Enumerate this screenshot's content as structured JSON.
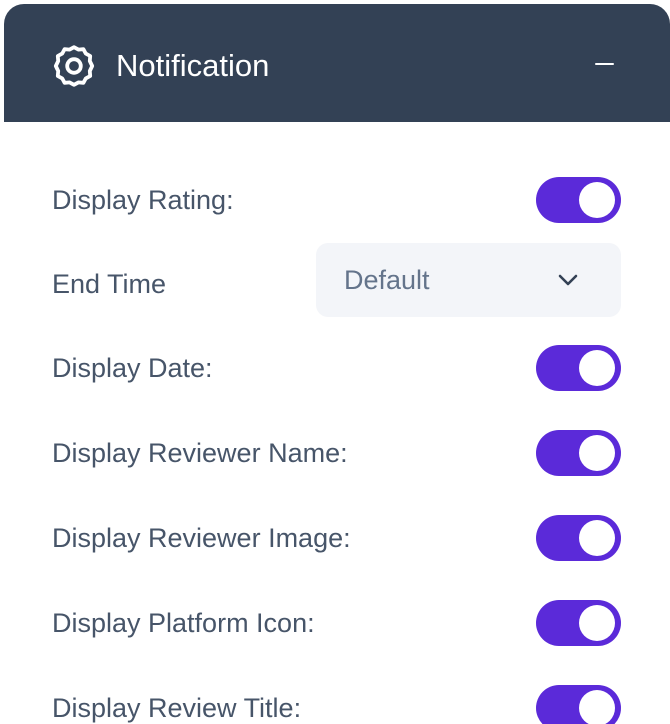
{
  "header": {
    "title": "Notification",
    "icon": "gear-icon",
    "collapse_icon": "minus-icon"
  },
  "settings": [
    {
      "label": "Display Rating:",
      "type": "toggle",
      "on": true
    },
    {
      "label": "End Time",
      "type": "select",
      "value": "Default"
    },
    {
      "label": "Display Date:",
      "type": "toggle",
      "on": true
    },
    {
      "label": "Display Reviewer Name:",
      "type": "toggle",
      "on": true
    },
    {
      "label": "Display Reviewer Image:",
      "type": "toggle",
      "on": true
    },
    {
      "label": "Display Platform Icon:",
      "type": "toggle",
      "on": true
    },
    {
      "label": "Display Review Title:",
      "type": "toggle",
      "on": true
    }
  ],
  "colors": {
    "header_bg": "#334155",
    "toggle_on": "#5b2ad9",
    "label_text": "#475569",
    "select_bg": "#f3f5f9"
  }
}
